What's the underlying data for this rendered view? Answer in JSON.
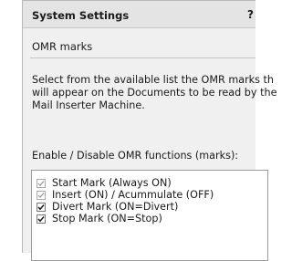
{
  "window": {
    "title": "System Settings",
    "help": "?"
  },
  "section": {
    "title": "OMR marks"
  },
  "description": {
    "line1": "Select from the available list the OMR marks th",
    "line2": "will appear on the Documents to be read by the",
    "line3": "Mail Inserter Machine."
  },
  "omr_list": {
    "label": "Enable / Disable OMR functions (marks):",
    "items": [
      {
        "label": "Start Mark (Always ON)",
        "checked": true,
        "enabled": false
      },
      {
        "label": "Insert (ON) / Acummulate (OFF)",
        "checked": true,
        "enabled": false
      },
      {
        "label": "Divert Mark (ON=Divert)",
        "checked": true,
        "enabled": true
      },
      {
        "label": "Stop Mark (ON=Stop)",
        "checked": true,
        "enabled": true
      }
    ]
  },
  "colors": {
    "check_enabled": "#1a1a1a",
    "check_disabled": "#9a9a9a"
  }
}
